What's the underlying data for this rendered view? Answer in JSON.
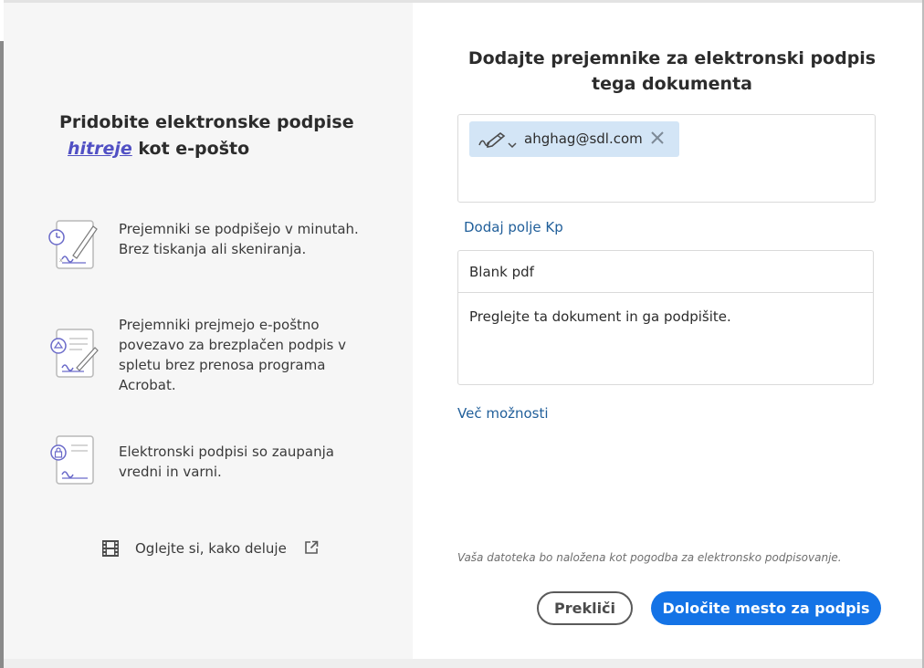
{
  "promo": {
    "title_line1": "Pridobite elektronske podpise",
    "title_emphasis": "hitreje",
    "title_rest": "kot e-pošto",
    "features": [
      {
        "icon": "signing-clock-icon",
        "text_lines": [
          "Prejemniki se podpišejo v minutah.",
          "Brez tiskanja ali skeniranja."
        ]
      },
      {
        "icon": "email-signature-icon",
        "text_lines": [
          "Prejemniki prejmejo e-poštno",
          "povezavo za brezplačen podpis v",
          "spletu brez prenosa programa",
          "Acrobat."
        ]
      },
      {
        "icon": "secure-document-icon",
        "text_lines": [
          "Elektronski podpisi so zaupanja",
          "vredni in varni."
        ]
      }
    ],
    "video_link": "Oglejte si, kako deluje"
  },
  "dialog": {
    "title_line1": "Dodajte prejemnike za elektronski podpis",
    "title_line2": "tega dokumenta",
    "recipient_email": "ahghag@sdl.com",
    "add_cc_label": "Dodaj polje Kp",
    "document_name": "Blank pdf",
    "message": "Preglejte ta dokument in ga podpišite.",
    "more_options": "Več možnosti",
    "upload_note": "Vaša datoteka bo naložena kot pogodba za elektronsko podpisovanje.",
    "cancel_label": "Prekliči",
    "primary_label": "Določite mesto za podpis"
  },
  "colors": {
    "accent": "#1473e6",
    "link": "#215f9a",
    "emphasis": "#5150c4",
    "chip": "#d3e5f6",
    "panel": "#f6f6f6"
  }
}
